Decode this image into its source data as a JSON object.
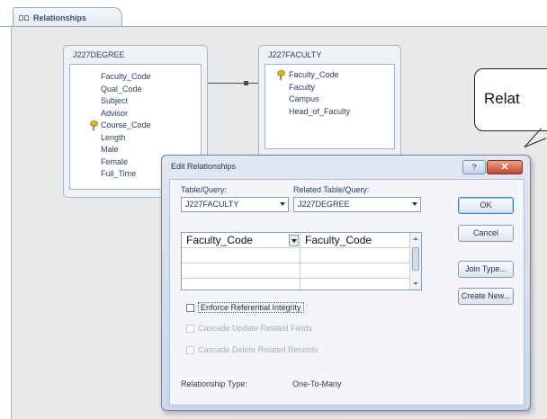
{
  "window": {
    "tab_label": "Relationships"
  },
  "tables": [
    {
      "title": "J227DEGREE",
      "fields": [
        "Faculty_Code",
        "Qual_Code",
        "Subject",
        "Advisor",
        "Course_Code",
        "Length",
        "Male",
        "Female",
        "Full_Time"
      ],
      "key_field_index": 4
    },
    {
      "title": "J227FACULTY",
      "fields": [
        "Faculty_Code",
        "Faculty",
        "Campus",
        "Head_of_Faculty"
      ],
      "key_field_index": 0
    }
  ],
  "callout": {
    "text": "Relat"
  },
  "dialog": {
    "title": "Edit Relationships",
    "help_label": "?",
    "close_label": "✕",
    "table_query_label": "Table/Query:",
    "related_table_query_label": "Related Table/Query:",
    "table_query_value": "J227FACULTY",
    "related_table_query_value": "J227DEGREE",
    "grid_rows": [
      {
        "left": "Faculty_Code",
        "right": "Faculty_Code"
      },
      {
        "left": "",
        "right": ""
      },
      {
        "left": "",
        "right": ""
      }
    ],
    "enforce_label": "Enforce Referential Integrity",
    "cascade_update_label": "Cascade Update Related Fields",
    "cascade_delete_label": "Cascade Delete Related Records",
    "relationship_type_label": "Relationship Type:",
    "relationship_type_value": "One-To-Many",
    "buttons": {
      "ok": "OK",
      "cancel": "Cancel",
      "join_type": "Join Type...",
      "create_new": "Create New..."
    }
  }
}
